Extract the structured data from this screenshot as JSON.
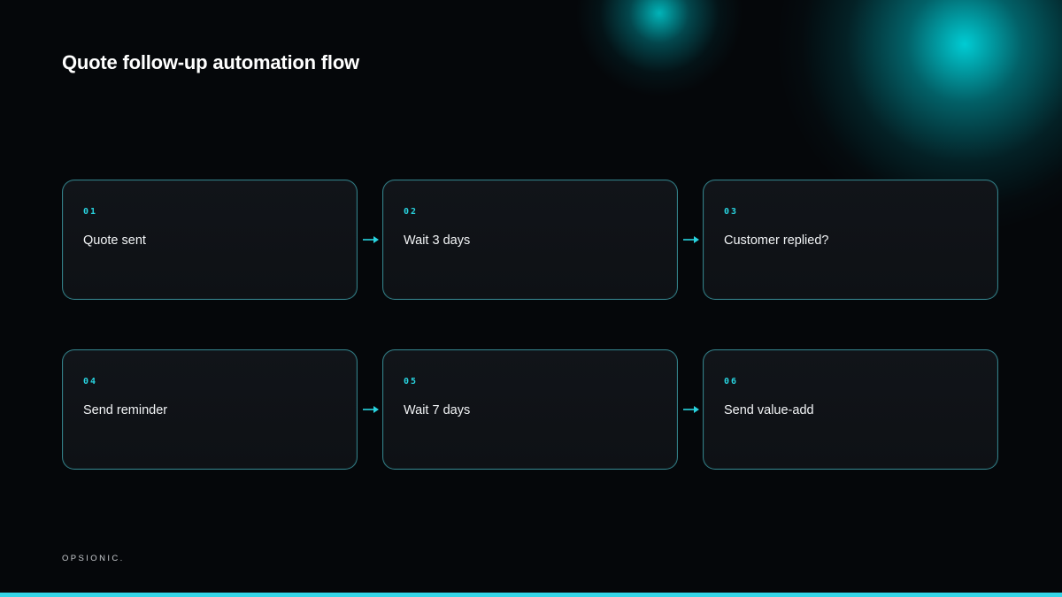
{
  "slide": {
    "title": "Quote follow-up automation flow",
    "brand": "OPSIONIC."
  },
  "steps": [
    {
      "num": "01",
      "label": "Quote sent"
    },
    {
      "num": "02",
      "label": "Wait 3 days"
    },
    {
      "num": "03",
      "label": "Customer replied?"
    },
    {
      "num": "04",
      "label": "Send reminder"
    },
    {
      "num": "05",
      "label": "Wait 7 days"
    },
    {
      "num": "06",
      "label": "Send value-add"
    }
  ],
  "colors": {
    "background": "#05070a",
    "accent": "#28d3df",
    "card_border": "#50d7e1",
    "card_fill": "#111419",
    "bottom_bar": "#35d6e8"
  },
  "icons": {
    "connector": "arrow-right-icon"
  }
}
